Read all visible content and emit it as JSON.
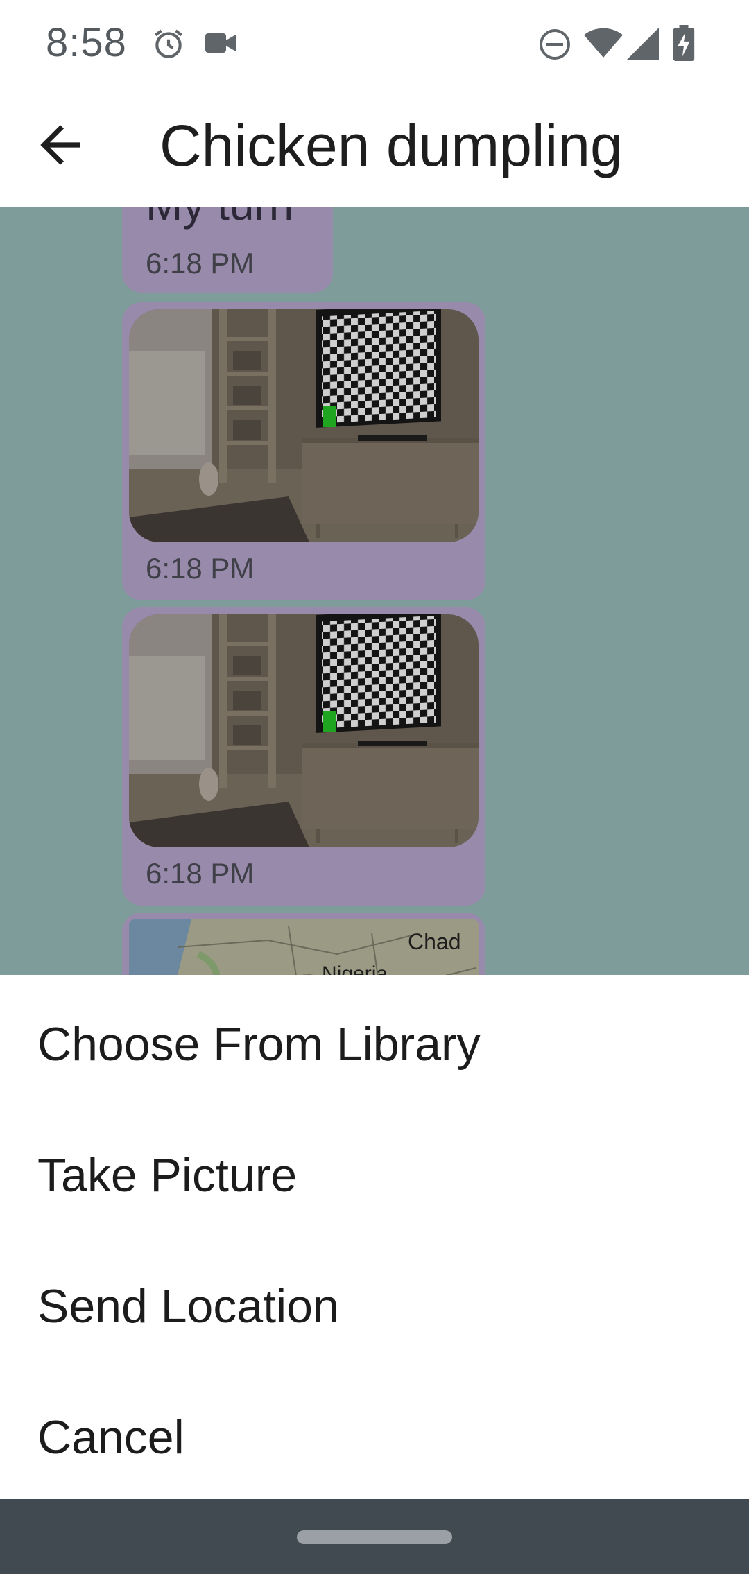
{
  "status_bar": {
    "time": "8:58",
    "icons": [
      "alarm-icon",
      "video-camera-icon",
      "do-not-disturb-icon",
      "wifi-icon",
      "cell-signal-icon",
      "battery-charging-icon"
    ]
  },
  "app_bar": {
    "back_icon": "arrow-back-icon",
    "title": "Chicken dumpling"
  },
  "messages": [
    {
      "type": "text",
      "text": "My turn",
      "time": "6:18 PM"
    },
    {
      "type": "image",
      "image": "chessboard-tv-room-photo",
      "time": "6:18 PM"
    },
    {
      "type": "image",
      "image": "chessboard-tv-room-photo",
      "time": "6:18 PM"
    },
    {
      "type": "location",
      "map_labels": [
        "Chad",
        "Nigeria"
      ]
    }
  ],
  "bottom_sheet": {
    "options": [
      "Choose From Library",
      "Take Picture",
      "Send Location",
      "Cancel"
    ]
  },
  "colors": {
    "chat_background": "#7e9c9a",
    "bubble": "#978aaa",
    "nav_bar": "#414a51"
  }
}
